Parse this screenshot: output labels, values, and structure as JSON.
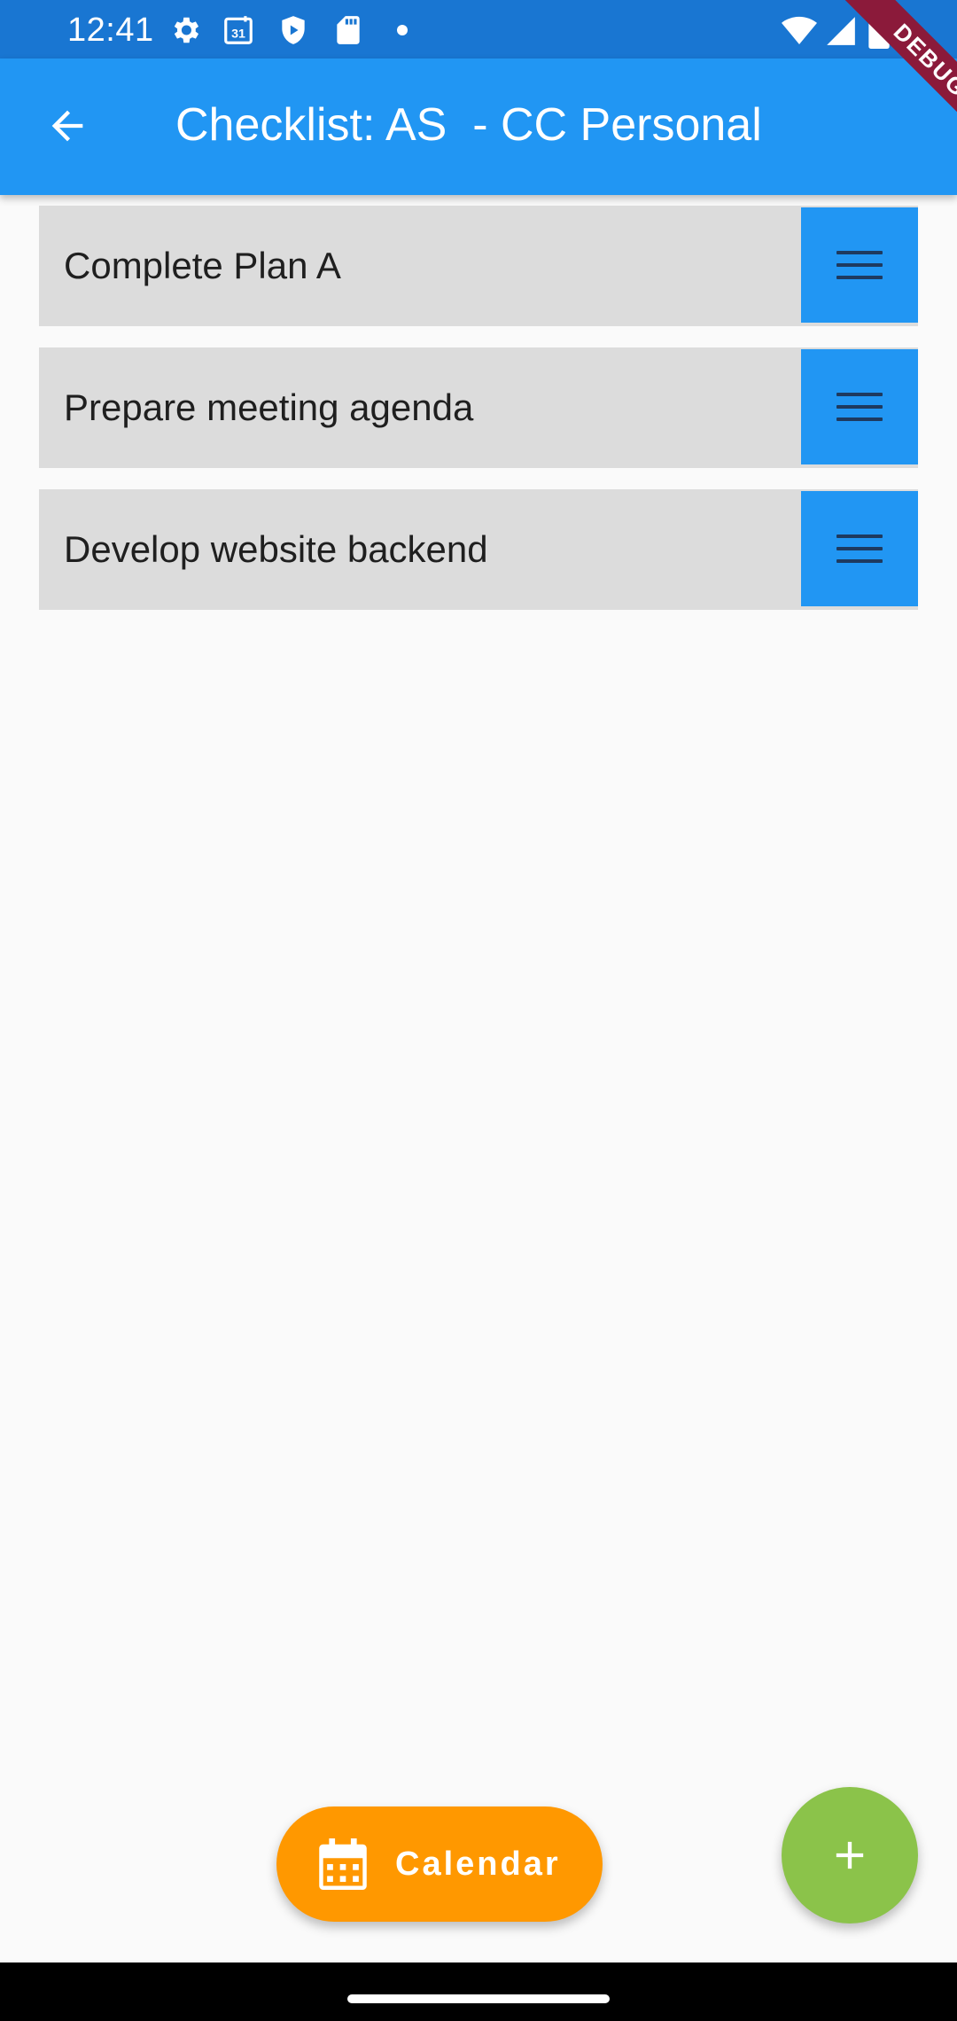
{
  "status_bar": {
    "time": "12:41",
    "icons": [
      "gear-icon",
      "calendar-31-icon",
      "shield-play-icon",
      "sd-card-icon",
      "dot-icon",
      "wifi-icon",
      "signal-icon",
      "battery-icon"
    ],
    "calendar_badge": "31"
  },
  "app_bar": {
    "title": "Checklist: AS  - CC Personal",
    "back_icon": "arrow-back-icon",
    "color": "#2196f3"
  },
  "debug_banner": {
    "label": "DEBUG"
  },
  "checklist": {
    "items": [
      {
        "label": "Complete Plan A"
      },
      {
        "label": "Prepare meeting agenda"
      },
      {
        "label": "Develop website backend"
      }
    ],
    "item_background": "#dcdcdc",
    "handle_color": "#2196f3",
    "handle_icon": "drag-handle-icon"
  },
  "calendar_button": {
    "label": "Calendar",
    "icon": "calendar-icon",
    "color": "#ff9800"
  },
  "add_button": {
    "icon": "plus-icon",
    "color": "#8bc34a"
  }
}
